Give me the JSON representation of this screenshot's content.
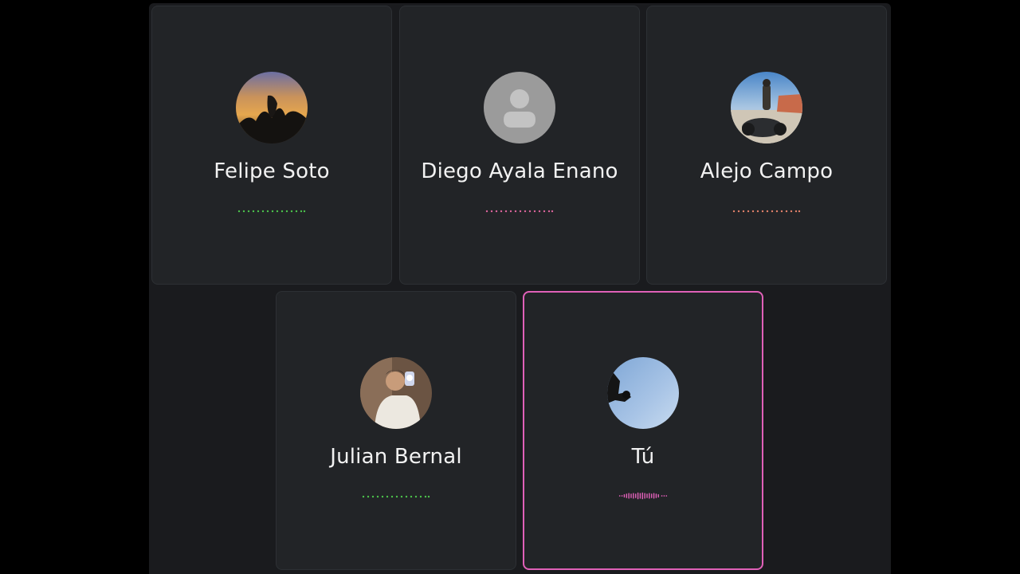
{
  "window": {
    "close_icon": "close-icon"
  },
  "participants": [
    {
      "name": "Felipe Soto",
      "avatar": "sunset-photo",
      "meter_color": "#4cc14c",
      "speaking": false
    },
    {
      "name": "Diego Ayala Enano",
      "avatar": "default-user-icon",
      "meter_color": "#d9649a",
      "speaking": false
    },
    {
      "name": "Alejo Campo",
      "avatar": "motorcycle-photo",
      "meter_color": "#e0806a",
      "speaking": false
    },
    {
      "name": "Julian Bernal",
      "avatar": "mirror-selfie-photo",
      "meter_color": "#4cc14c",
      "speaking": false
    },
    {
      "name": "Tú",
      "avatar": "sky-photo",
      "meter_color": "#e060b8",
      "speaking": true
    }
  ],
  "colors": {
    "active_border": "#e060b8",
    "card_bg": "#222427",
    "window_bg": "#1a1b1e"
  }
}
